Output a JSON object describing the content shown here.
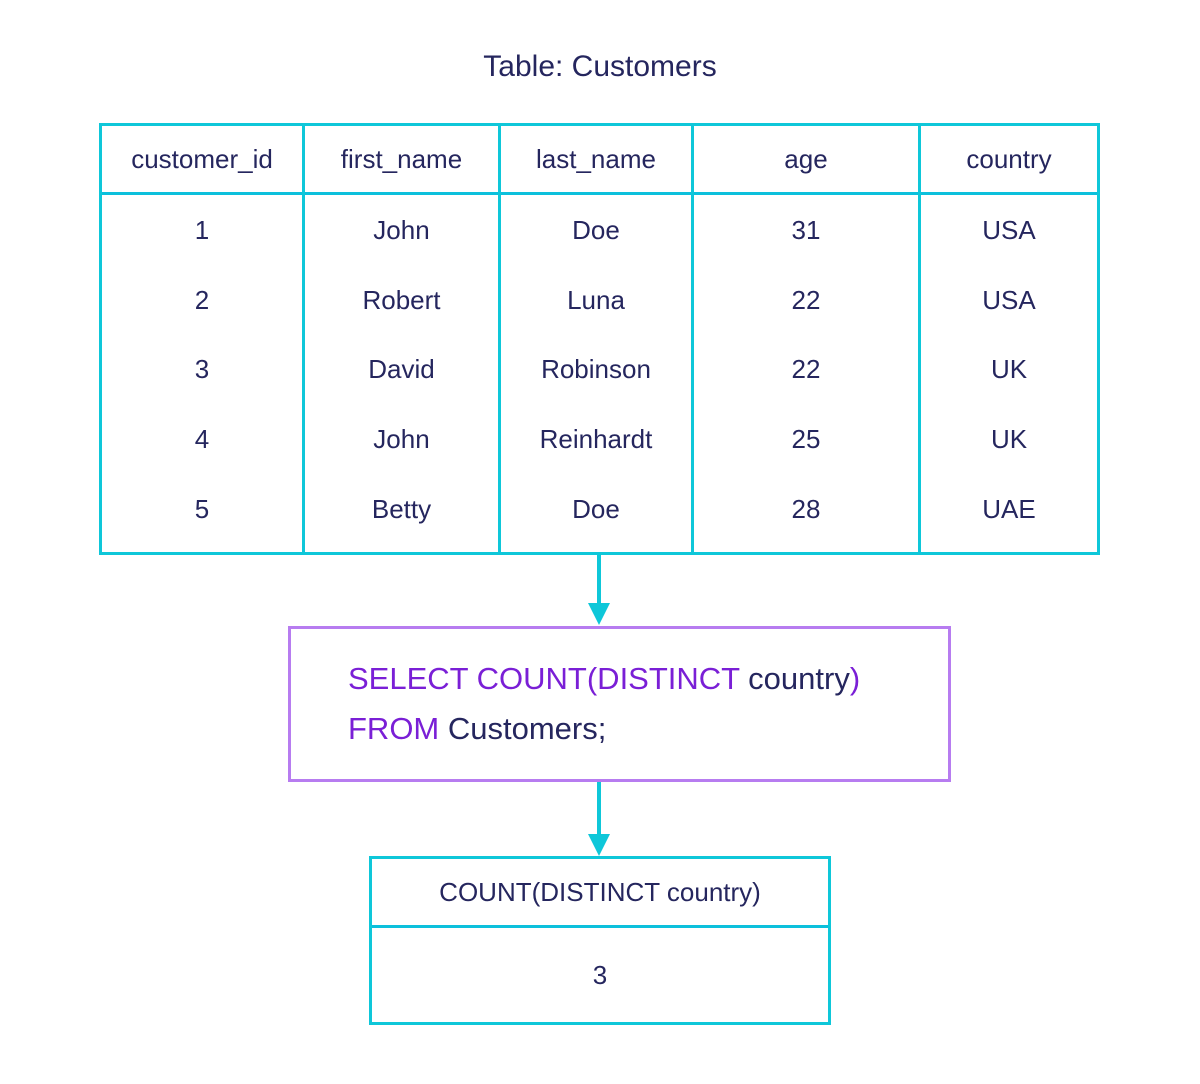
{
  "title": "Table: Customers",
  "customers_table": {
    "columns": [
      "customer_id",
      "first_name",
      "last_name",
      "age",
      "country"
    ],
    "rows": [
      [
        "1",
        "John",
        "Doe",
        "31",
        "USA"
      ],
      [
        "2",
        "Robert",
        "Luna",
        "22",
        "USA"
      ],
      [
        "3",
        "David",
        "Robinson",
        "22",
        "UK"
      ],
      [
        "4",
        "John",
        "Reinhardt",
        "25",
        "UK"
      ],
      [
        "5",
        "Betty",
        "Doe",
        "28",
        "UAE"
      ]
    ]
  },
  "query": {
    "line1": [
      {
        "text": "SELECT COUNT(DISTINCT ",
        "kind": "keyword"
      },
      {
        "text": "country",
        "kind": "text"
      },
      {
        "text": ")",
        "kind": "keyword"
      }
    ],
    "line2": [
      {
        "text": "FROM ",
        "kind": "keyword"
      },
      {
        "text": "Customers;",
        "kind": "text"
      }
    ]
  },
  "result_table": {
    "column": "COUNT(DISTINCT country)",
    "value": "3"
  },
  "colors": {
    "table_border": "#0ec7d9",
    "query_border": "#b77cf0",
    "keyword": "#7a1fd6",
    "text": "#25265e"
  }
}
